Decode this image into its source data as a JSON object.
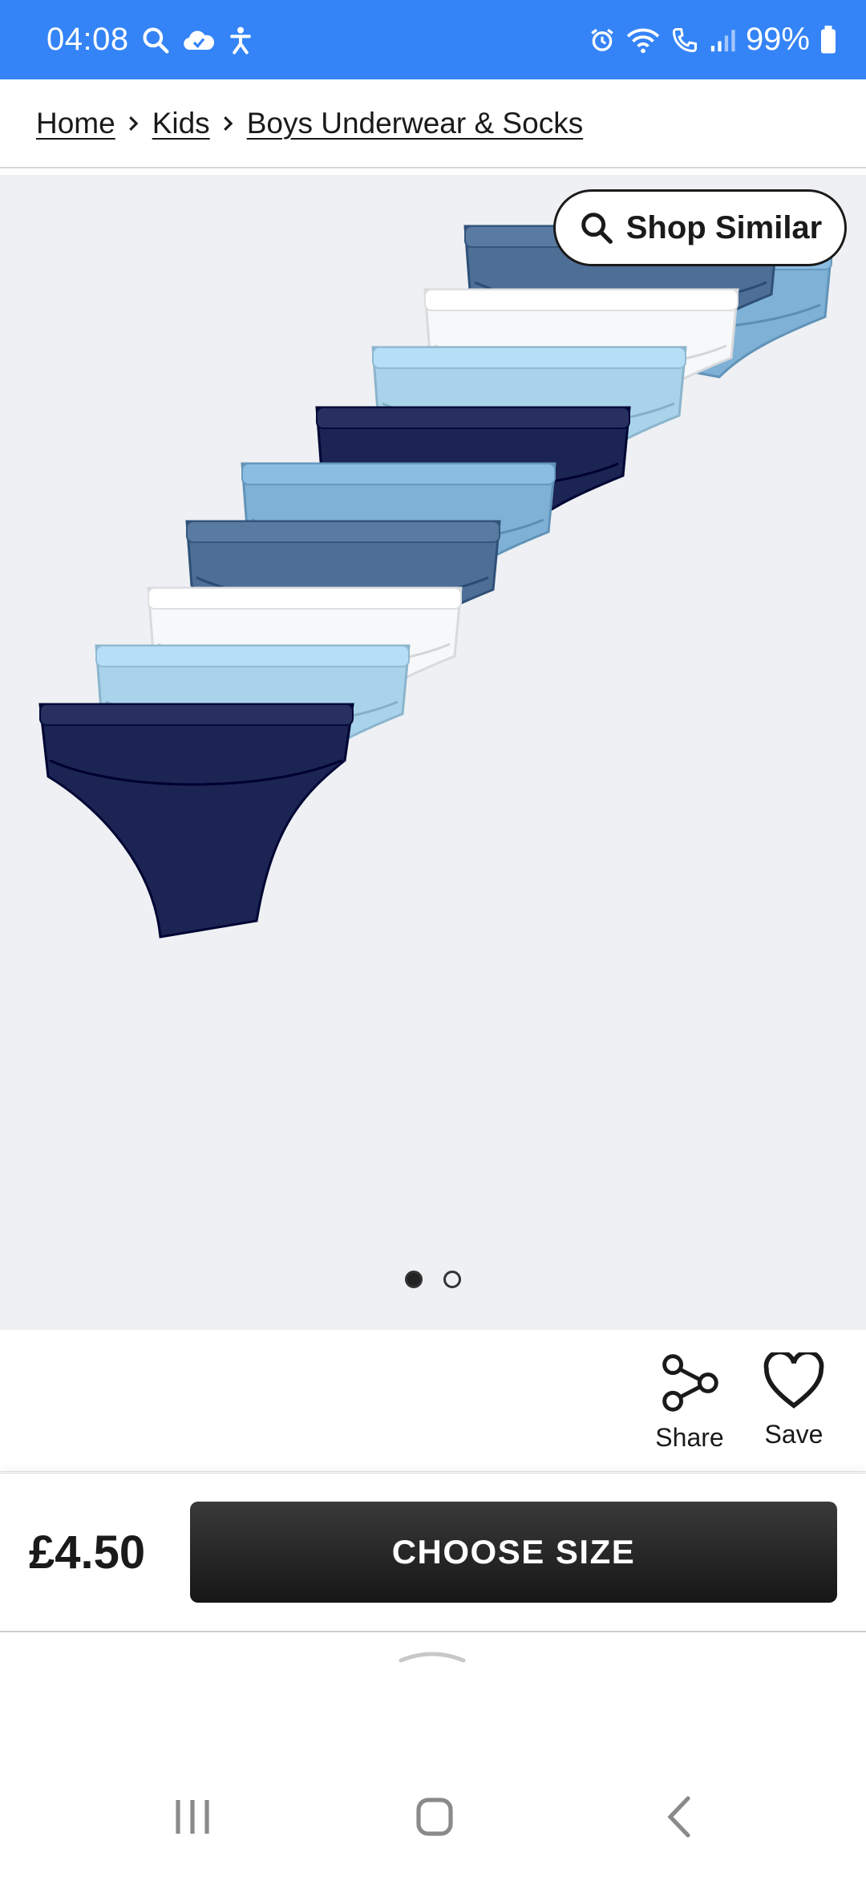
{
  "status_bar": {
    "time": "04:08",
    "battery": "99%",
    "background": "#3584f7"
  },
  "breadcrumb": {
    "items": [
      "Home",
      "Kids",
      "Boys Underwear & Socks"
    ]
  },
  "gallery": {
    "shop_similar_label": "Shop Similar",
    "page_count": 2,
    "active_page": 1
  },
  "actions": {
    "share_label": "Share",
    "save_label": "Save"
  },
  "purchase": {
    "price": "£4.50",
    "choose_size_label": "CHOOSE SIZE"
  },
  "colors": {
    "light_blue": "#7fb1d6",
    "steel_blue": "#4d6e95",
    "white": "#f7f8fa",
    "pale_blue": "#a9d3ea",
    "navy": "#1b2452"
  }
}
